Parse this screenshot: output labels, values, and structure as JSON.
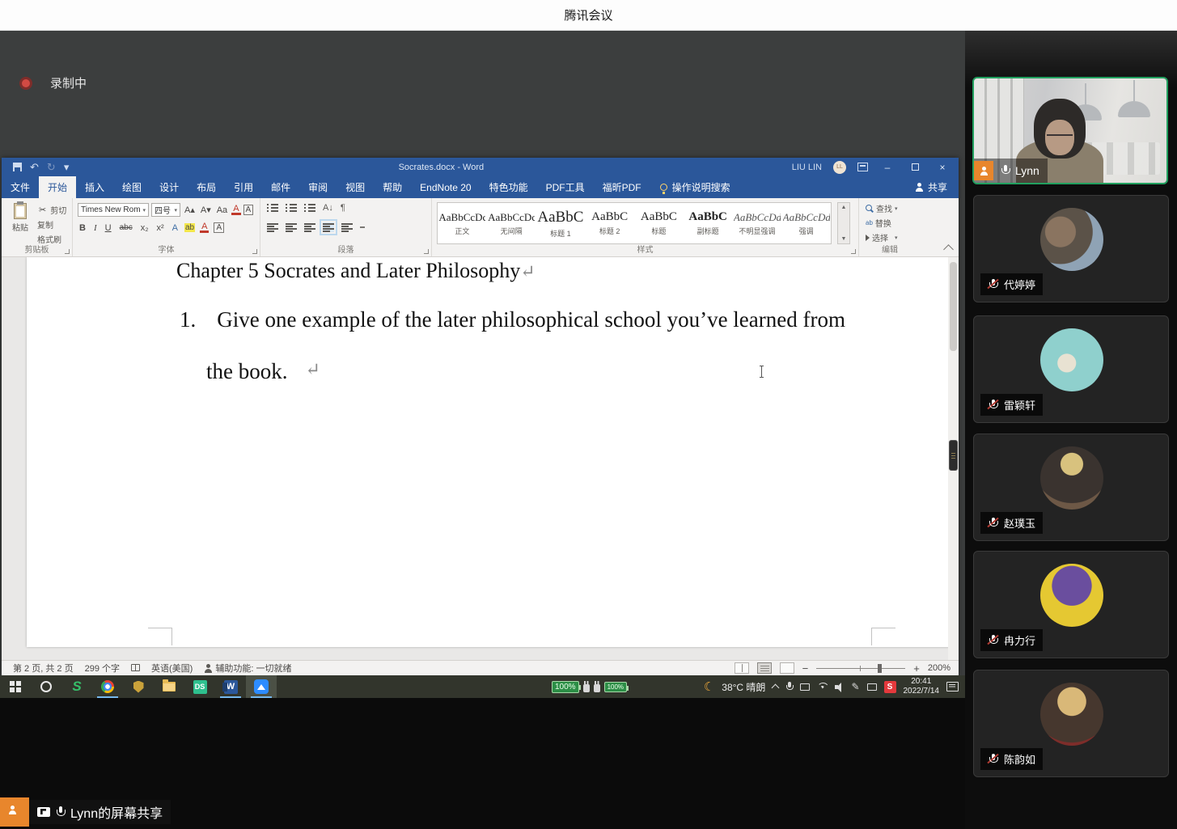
{
  "colors": {
    "titlebar_blue": "#2b579a",
    "recording_red": "#d24a43",
    "active_speaker_green": "#21a05f",
    "badge_orange": "#e8862c",
    "taskbar_dark": "#32352c"
  },
  "top_bar": {
    "title": "腾讯会议"
  },
  "meeting": {
    "recording_label": "录制中",
    "share_banner_label": "Lynn的屏幕共享",
    "participants": [
      {
        "name": "Lynn",
        "muted": false,
        "video": true
      },
      {
        "name": "代婷婷",
        "muted": true
      },
      {
        "name": "雷颖轩",
        "muted": true
      },
      {
        "name": "赵璞玉",
        "muted": true
      },
      {
        "name": "冉力行",
        "muted": true
      },
      {
        "name": "陈韵如",
        "muted": true
      }
    ]
  },
  "word": {
    "window_title": "Socrates.docx  -  Word",
    "account_name": "LIU LIN",
    "account_initials": "LL",
    "tabs": [
      "文件",
      "开始",
      "插入",
      "绘图",
      "设计",
      "布局",
      "引用",
      "邮件",
      "审阅",
      "视图",
      "帮助",
      "EndNote 20",
      "特色功能",
      "PDF工具",
      "福昕PDF"
    ],
    "active_tab": "开始",
    "tell_me_label": "操作说明搜索",
    "share_label": "共享",
    "ribbon": {
      "paste_label": "粘贴",
      "cut_label": "剪切",
      "copy_label": "复制",
      "format_painter_label": "格式刷",
      "clipboard_group_label": "剪贴板",
      "font_name": "Times New Rom",
      "font_size": "四号",
      "font_group_label": "字体",
      "paragraph_group_label": "段落",
      "styles_group_label": "样式",
      "styles": [
        {
          "sample": "AaBbCcDc",
          "name": "正文"
        },
        {
          "sample": "AaBbCcDc",
          "name": "无间隔"
        },
        {
          "sample": "AaBbC",
          "name": "标题 1"
        },
        {
          "sample": "AaBbC",
          "name": "标题 2"
        },
        {
          "sample": "AaBbC",
          "name": "标题"
        },
        {
          "sample": "AaBbC",
          "name": "副标题"
        },
        {
          "sample": "AaBbCcDd",
          "name": "不明显强调"
        },
        {
          "sample": "AaBbCcDd",
          "name": "强调"
        }
      ],
      "find_label": "查找",
      "replace_label": "替换",
      "select_label": "选择",
      "editing_group_label": "编辑"
    },
    "document": {
      "heading": "Chapter 5 Socrates and Later Philosophy",
      "list_number": "1.",
      "body_line1": "Give one example of the later philosophical school you’ve learned from",
      "body_line2": "the book.",
      "paragraph_mark": "↵"
    },
    "status_bar": {
      "page_info": "第 2 页, 共 2 页",
      "word_count": "299 个字",
      "language": "英语(美国)",
      "accessibility": "辅助功能: 一切就绪",
      "zoom_level": "200%"
    }
  },
  "taskbar": {
    "battery1": "100%",
    "battery2": "100%",
    "weather": "38°C 晴朗",
    "time": "20:41",
    "date": "2022/7/14",
    "ds_label": "DS",
    "word_label": "W",
    "sogou_label": "S",
    "green_app_label": "S"
  },
  "icons": {
    "undo": "↶",
    "redo": "↻",
    "dropdown": "▾",
    "scissors": "✂",
    "bold": "B",
    "italic": "I",
    "underline": "U",
    "strikethrough": "abc",
    "subscript": "x₂",
    "superscript": "x²",
    "grow_font": "A▴",
    "shrink_font": "A▾",
    "change_case": "Aa",
    "text_effects": "A",
    "highlight": "ab",
    "font_color": "A",
    "char_border": "A",
    "sort": "A↓",
    "pilcrow": "¶",
    "scroll_up": "▲",
    "scroll_down": "▼",
    "minimize": "–",
    "close": "×",
    "minus": "−",
    "plus": "+",
    "pen": "✎",
    "moon": "☾",
    "replace_ab": "ab"
  }
}
